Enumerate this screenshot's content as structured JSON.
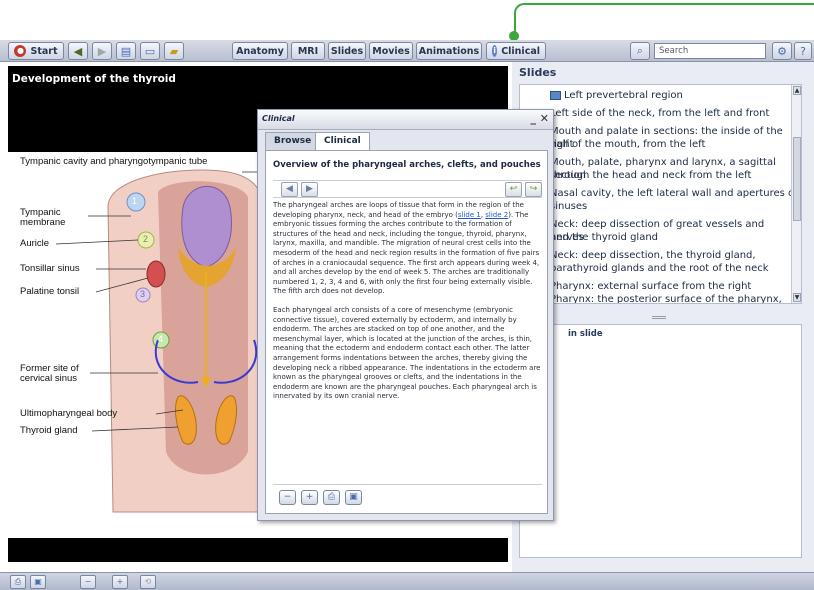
{
  "toolbar": {
    "start_label": "Start",
    "tabs": [
      "Anatomy",
      "MRI",
      "Slides",
      "Movies",
      "Animations",
      "Clinical"
    ],
    "search_placeholder": "Search"
  },
  "viewer": {
    "title": "Development of the thyroid",
    "labels": [
      "Tympanic cavity and pharyngotympanic tube",
      "Tympanic",
      "membrane",
      "Auricle",
      "Tonsillar sinus",
      "Palatine tonsil",
      "Former site of",
      "cervical sinus",
      "Ultimopharyngeal body",
      "Thyroid gland"
    ],
    "arch_numbers": [
      "1",
      "2",
      "3",
      "4"
    ]
  },
  "right_panel": {
    "title": "Slides",
    "slides": [
      "Left prevertebral region",
      "Left side of the neck, from the left and front",
      "Mouth and palate in sections: the inside of the right",
      "half of the mouth, from the left",
      "Mouth, palate, pharynx and larynx, a sagittal section",
      "through the head and neck from the left",
      "Nasal cavity, the left lateral wall and apertures of",
      "sinuses",
      "Neck: deep dissection of great vessels and nerves",
      "and the thyroid gland",
      "Neck: deep dissection, the thyroid gland,",
      "parathyroid glands and the root of the neck",
      "Pharynx: external surface from the right",
      "Pharynx: the posterior surface of the pharynx, the"
    ],
    "in_slide_label": "in slide"
  },
  "popup": {
    "title": "Clinical",
    "tabs": [
      "Browse",
      "Clinical"
    ],
    "heading": "Overview of the pharyngeal arches, clefts, and pouches",
    "para1_a": "The pharyngeal arches are loops of tissue that form in the region of the developing pharynx, neck, and head of the embryo (",
    "link1": "slide 1",
    "para1_sep": ", ",
    "link2": "slide 2",
    "para1_b": "). The embryonic tissues forming the arches contribute to the formation of structures of the head and neck, including the tongue, thyroid, pharynx, larynx, maxilla, and mandible. The migration of neural crest cells into the mesoderm of the head and neck region results in the formation of five pairs of arches in a craniocaudal sequence. The first arch appears during week 4, and all arches develop by the end of week 5. The arches are traditionally numbered 1, 2, 3, 4 and 6, with only the first four being externally visible. The fifth arch does not develop.",
    "para2": "Each pharyngeal arch consists of a core of mesenchyme (embryonic connective tissue), covered externally by ectoderm, and internally by endoderm. The arches are stacked on top of one another, and the mesenchymal layer, which is located at the junction of the arches, is thin, meaning that the ectoderm and endoderm contact each other. The latter arrangement forms indentations between the arches, thereby giving the developing neck a ribbed appearance. The indentations in the ectoderm are known as the pharyngeal grooves or clefts, and the indentations in the endoderm are known are the pharyngeal pouches. Each pharyngeal arch is innervated by its own cranial nerve."
  },
  "colors": {
    "accent_green": "#3aa83a",
    "toolbar_bg": "#c8cedd",
    "link_blue": "#2458c8"
  }
}
